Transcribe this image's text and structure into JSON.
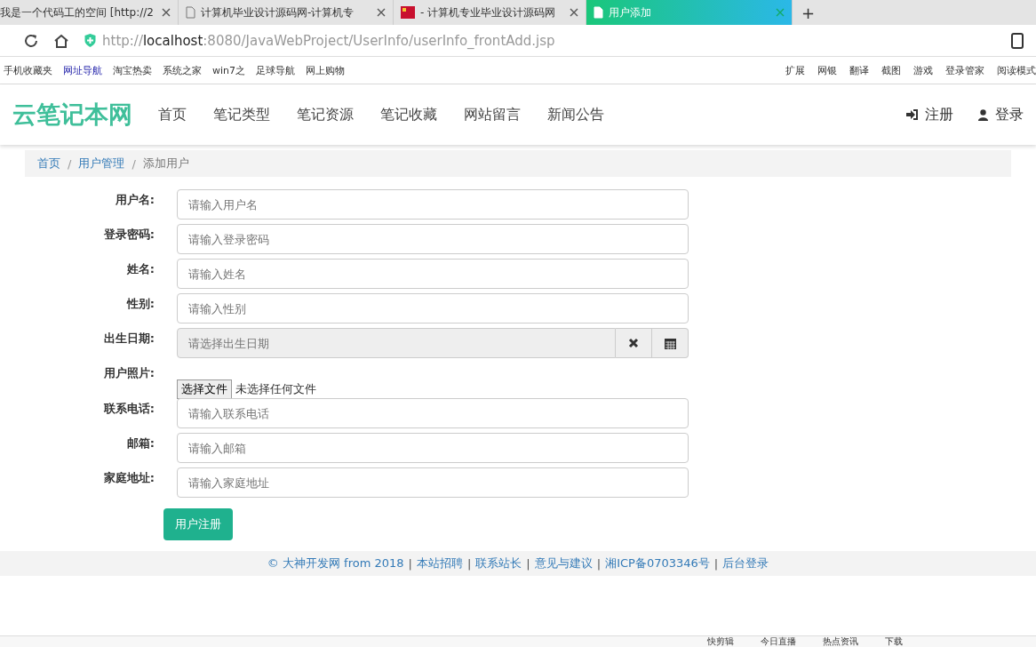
{
  "browser": {
    "tabs": [
      {
        "title": "我是一个代码工的空间 [http://2",
        "selected": false,
        "kind": "plain"
      },
      {
        "title": "计算机毕业设计源码网-计算机专",
        "selected": false,
        "kind": "page"
      },
      {
        "title": "- 计算机专业毕业设计源码网",
        "selected": false,
        "kind": "flag"
      },
      {
        "title": "用户添加",
        "selected": true,
        "kind": "page"
      }
    ],
    "new_tab": "+",
    "address": {
      "scheme": "http://",
      "host": "localhost",
      "rest": ":8080/JavaWebProject/UserInfo/userInfo_frontAdd.jsp"
    },
    "bookmarks": [
      "手机收藏夹",
      "网址导航",
      "淘宝热卖",
      "系统之家",
      "win7之",
      "足球导航",
      "网上购物"
    ],
    "tools": [
      "扩展",
      "网银",
      "翻译",
      "截图",
      "游戏",
      "登录管家",
      "阅读模式"
    ]
  },
  "site": {
    "logo": "云笔记本网",
    "nav": [
      "首页",
      "笔记类型",
      "笔记资源",
      "笔记收藏",
      "网站留言",
      "新闻公告"
    ],
    "user_links": [
      {
        "label": "注册",
        "kind": "register"
      },
      {
        "label": "登录",
        "kind": "login"
      }
    ]
  },
  "breadcrumb_separator": "/",
  "footer_separator": "|",
  "breadcrumb": [
    {
      "label": "首页",
      "kind": "link"
    },
    {
      "label": "用户管理",
      "kind": "link"
    },
    {
      "label": "添加用户",
      "kind": "current"
    }
  ],
  "form": {
    "fields": [
      {
        "label": "用户名:",
        "kind": "text",
        "placeholder": "请输入用户名"
      },
      {
        "label": "登录密码:",
        "kind": "text",
        "placeholder": "请输入登录密码"
      },
      {
        "label": "姓名:",
        "kind": "text",
        "placeholder": "请输入姓名"
      },
      {
        "label": "性别:",
        "kind": "text",
        "placeholder": "请输入性别"
      },
      {
        "label": "出生日期:",
        "kind": "date",
        "placeholder": "请选择出生日期"
      },
      {
        "label": "用户照片:",
        "kind": "file",
        "button": "选择文件",
        "status": "未选择任何文件"
      },
      {
        "label": "联系电话:",
        "kind": "text",
        "placeholder": "请输入联系电话"
      },
      {
        "label": "邮箱:",
        "kind": "text",
        "placeholder": "请输入邮箱"
      },
      {
        "label": "家庭地址:",
        "kind": "text",
        "placeholder": "请输入家庭地址"
      }
    ],
    "submit": "用户注册"
  },
  "footer": [
    "© 大神开发网 from 2018",
    "本站招聘",
    "联系站长",
    "意见与建议",
    "湘ICP备0703346号",
    "后台登录"
  ],
  "status_bar": [
    "快剪辑",
    "今日直播",
    "热点资讯",
    "下载"
  ]
}
